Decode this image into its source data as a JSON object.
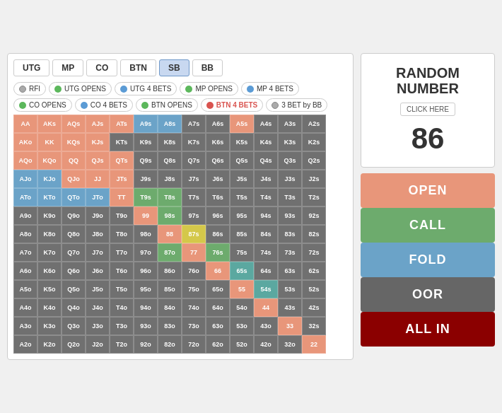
{
  "positions": [
    {
      "label": "UTG",
      "active": false
    },
    {
      "label": "MP",
      "active": false
    },
    {
      "label": "CO",
      "active": false
    },
    {
      "label": "BTN",
      "active": false
    },
    {
      "label": "SB",
      "active": true
    },
    {
      "label": "BB",
      "active": false
    }
  ],
  "action_row1": [
    {
      "label": "RFI",
      "dot": "gray",
      "icon": "●"
    },
    {
      "label": "UTG OPENS",
      "dot": "green",
      "icon": "▶"
    },
    {
      "label": "UTG 4 BETS",
      "dot": "blue",
      "icon": "◀"
    },
    {
      "label": "MP OPENS",
      "dot": "green",
      "icon": "▶"
    },
    {
      "label": "MP 4 BETS",
      "dot": "blue",
      "icon": "◀"
    }
  ],
  "action_row2": [
    {
      "label": "CO OPENS",
      "dot": "green",
      "icon": "▶",
      "highlight": false
    },
    {
      "label": "CO 4 BETS",
      "dot": "blue",
      "icon": "◀",
      "highlight": false
    },
    {
      "label": "BTN OPENS",
      "dot": "green",
      "icon": "▶",
      "highlight": false
    },
    {
      "label": "BTN 4 BETS",
      "dot": "red",
      "icon": "◀",
      "highlight": true
    },
    {
      "label": "3 BET by BB",
      "dot": "gray",
      "icon": "●",
      "highlight": false
    }
  ],
  "random": {
    "title_line1": "RANDOM",
    "title_line2": "NUMBER",
    "click_label": "CLICK HERE",
    "number": "86"
  },
  "action_buttons": [
    {
      "label": "OPEN",
      "class": "btn-open"
    },
    {
      "label": "CALL",
      "class": "btn-call"
    },
    {
      "label": "FOLD",
      "class": "btn-fold"
    },
    {
      "label": "OOR",
      "class": "btn-oor"
    },
    {
      "label": "ALL IN",
      "class": "btn-allin"
    }
  ],
  "grid": {
    "rows": [
      [
        "AA",
        "AKs",
        "AQs",
        "AJs",
        "ATs",
        "A9s",
        "A8s",
        "A7s",
        "A6s",
        "A5s",
        "A4s",
        "A3s",
        "A2s"
      ],
      [
        "AKo",
        "KK",
        "KQs",
        "KJs",
        "KTs",
        "K9s",
        "K8s",
        "K7s",
        "K6s",
        "K5s",
        "K4s",
        "K3s",
        "K2s"
      ],
      [
        "AQo",
        "KQo",
        "QQ",
        "QJs",
        "QTs",
        "Q9s",
        "Q8s",
        "Q7s",
        "Q6s",
        "Q5s",
        "Q4s",
        "Q3s",
        "Q2s"
      ],
      [
        "AJo",
        "KJo",
        "QJo",
        "JJ",
        "JTs",
        "J9s",
        "J8s",
        "J7s",
        "J6s",
        "J5s",
        "J4s",
        "J3s",
        "J2s"
      ],
      [
        "ATo",
        "KTo",
        "QTo",
        "JTo",
        "TT",
        "T9s",
        "T8s",
        "T7s",
        "T6s",
        "T5s",
        "T4s",
        "T3s",
        "T2s"
      ],
      [
        "A9o",
        "K9o",
        "Q9o",
        "J9o",
        "T9o",
        "99",
        "98s",
        "97s",
        "96s",
        "95s",
        "94s",
        "93s",
        "92s"
      ],
      [
        "A8o",
        "K8o",
        "Q8o",
        "J8o",
        "T8o",
        "98o",
        "88",
        "87s",
        "86s",
        "85s",
        "84s",
        "83s",
        "82s"
      ],
      [
        "A7o",
        "K7o",
        "Q7o",
        "J7o",
        "T7o",
        "97o",
        "87o",
        "77",
        "76s",
        "75s",
        "74s",
        "73s",
        "72s"
      ],
      [
        "A6o",
        "K6o",
        "Q6o",
        "J6o",
        "T6o",
        "96o",
        "86o",
        "76o",
        "66",
        "65s",
        "64s",
        "63s",
        "62s"
      ],
      [
        "A5o",
        "K5o",
        "Q5o",
        "J5o",
        "T5o",
        "95o",
        "85o",
        "75o",
        "65o",
        "55",
        "54s",
        "53s",
        "52s"
      ],
      [
        "A4o",
        "K4o",
        "Q4o",
        "J4o",
        "T4o",
        "94o",
        "84o",
        "74o",
        "64o",
        "54o",
        "44",
        "43s",
        "42s"
      ],
      [
        "A3o",
        "K3o",
        "Q3o",
        "J3o",
        "T3o",
        "93o",
        "83o",
        "73o",
        "63o",
        "53o",
        "43o",
        "33",
        "32s"
      ],
      [
        "A2o",
        "K2o",
        "Q2o",
        "J2o",
        "T2o",
        "92o",
        "82o",
        "72o",
        "62o",
        "52o",
        "42o",
        "32o",
        "22"
      ]
    ],
    "colors": [
      [
        "salmon",
        "salmon",
        "salmon",
        "salmon",
        "salmon",
        "blue",
        "blue",
        "gray",
        "gray",
        "salmon",
        "gray",
        "gray",
        "gray"
      ],
      [
        "salmon",
        "salmon",
        "salmon",
        "salmon",
        "gray",
        "gray",
        "gray",
        "gray",
        "gray",
        "gray",
        "gray",
        "gray",
        "gray"
      ],
      [
        "salmon",
        "salmon",
        "salmon",
        "salmon",
        "salmon",
        "gray",
        "gray",
        "gray",
        "gray",
        "gray",
        "gray",
        "gray",
        "gray"
      ],
      [
        "blue",
        "blue",
        "salmon",
        "salmon",
        "salmon",
        "gray",
        "gray",
        "gray",
        "gray",
        "gray",
        "gray",
        "gray",
        "gray"
      ],
      [
        "blue",
        "blue",
        "blue",
        "blue",
        "salmon",
        "green",
        "green",
        "gray",
        "gray",
        "gray",
        "gray",
        "gray",
        "gray"
      ],
      [
        "gray",
        "gray",
        "gray",
        "gray",
        "gray",
        "salmon",
        "green",
        "gray",
        "gray",
        "gray",
        "gray",
        "gray",
        "gray"
      ],
      [
        "gray",
        "gray",
        "gray",
        "gray",
        "gray",
        "gray",
        "salmon",
        "yellow",
        "gray",
        "gray",
        "gray",
        "gray",
        "gray"
      ],
      [
        "gray",
        "gray",
        "gray",
        "gray",
        "gray",
        "gray",
        "green",
        "salmon",
        "green",
        "gray",
        "gray",
        "gray",
        "gray"
      ],
      [
        "gray",
        "gray",
        "gray",
        "gray",
        "gray",
        "gray",
        "gray",
        "gray",
        "salmon",
        "teal",
        "gray",
        "gray",
        "gray"
      ],
      [
        "gray",
        "gray",
        "gray",
        "gray",
        "gray",
        "gray",
        "gray",
        "gray",
        "gray",
        "salmon",
        "teal",
        "gray",
        "gray"
      ],
      [
        "gray",
        "gray",
        "gray",
        "gray",
        "gray",
        "gray",
        "gray",
        "gray",
        "gray",
        "gray",
        "salmon",
        "gray",
        "gray"
      ],
      [
        "gray",
        "gray",
        "gray",
        "gray",
        "gray",
        "gray",
        "gray",
        "gray",
        "gray",
        "gray",
        "gray",
        "salmon",
        "gray"
      ],
      [
        "gray",
        "gray",
        "gray",
        "gray",
        "gray",
        "gray",
        "gray",
        "gray",
        "gray",
        "gray",
        "gray",
        "gray",
        "salmon"
      ]
    ]
  }
}
